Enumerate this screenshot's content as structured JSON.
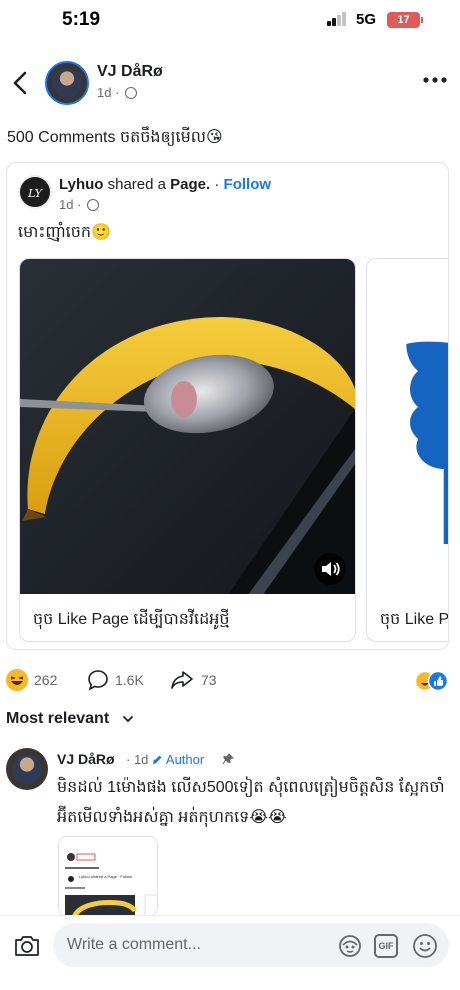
{
  "status_bar": {
    "time": "5:19",
    "network": "5G",
    "battery": "17"
  },
  "header": {
    "poster_name": "VJ DåRø",
    "post_time": "1d ·"
  },
  "post": {
    "caption": "500 Comments ចតចឹងឲ្យមើល😘"
  },
  "shared": {
    "page_logo_text": "LY",
    "page_name": "Lyhuo",
    "shared_text": " shared a ",
    "page_word": "Page.",
    "separator": " · ",
    "follow_label": "Follow",
    "time": "1d ·",
    "caption": "មោះញ៉ាំចេក🙂",
    "cards": [
      {
        "caption": "ចុច Like Page ដើម្បីបានវីដេអូថ្មី"
      },
      {
        "caption": "ចុច Like Pa"
      }
    ]
  },
  "reactions": {
    "count": "262",
    "comments": "1.6K",
    "shares": "73"
  },
  "sort": {
    "label": "Most relevant"
  },
  "comment": {
    "name": "VJ DåRø",
    "time": "· 1d ·",
    "author_badge": "Author",
    "text": "មិនដល់ 1ម៉ោងផង លើស500ទៀត សុំពេលត្រៀមចិត្តសិន ស្អែកចាំអ៊ីតមើលទាំងអស់គ្នា អត់កុហកទេ😭😭",
    "thumb_text": "Lyhuo shared a Page · Follow"
  },
  "composer": {
    "placeholder": "Write a comment..."
  },
  "icons": {
    "back": "chevron-left",
    "more": "ellipsis",
    "volume": "speaker",
    "camera": "camera",
    "gif": "GIF",
    "emoji": "smiley",
    "sticker": "avatar-sticker"
  },
  "colors": {
    "accent": "#1877f2",
    "battery": "#e05a5a",
    "muted_text": "#65676b"
  }
}
